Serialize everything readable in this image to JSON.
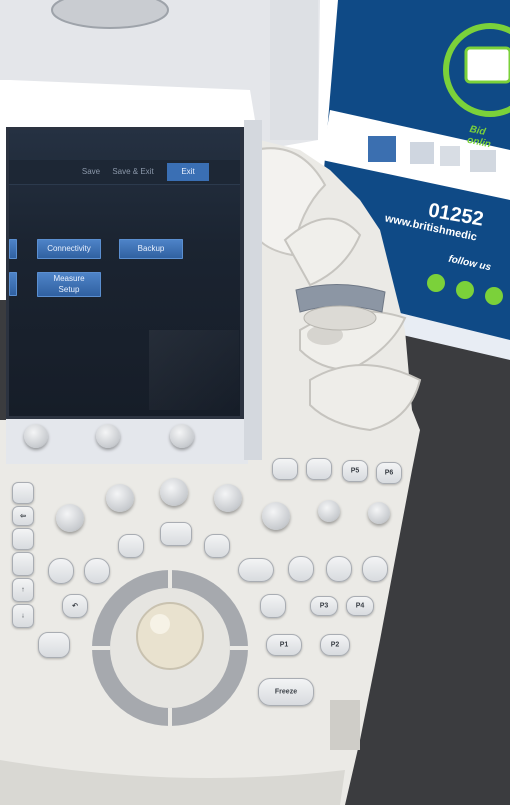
{
  "scene": {
    "description_colors": {
      "console": "#e9e8e4",
      "screen_bg": "#1b2431",
      "screen_button": "#3e73b8",
      "banner": "#0d4f8f",
      "banner_green": "#7bd13a",
      "floor": "#3a3b3d"
    }
  },
  "screen": {
    "top_buttons": {
      "save": "Save",
      "save_exit": "Save & Exit",
      "exit": "Exit"
    },
    "buttons": {
      "connectivity": "Connectivity",
      "backup": "Backup",
      "measure_setup_line1": "Measure",
      "measure_setup_line2": "Setup"
    }
  },
  "console_keys": {
    "p1": "P1",
    "p2": "P2",
    "p3": "P3",
    "p4": "P4",
    "p5": "P5",
    "p6": "P6",
    "freeze": "Freeze"
  },
  "banner": {
    "bid_text": "Bid onlin",
    "phone": "01252",
    "website": "www.britishmedic",
    "follow": "follow us"
  }
}
